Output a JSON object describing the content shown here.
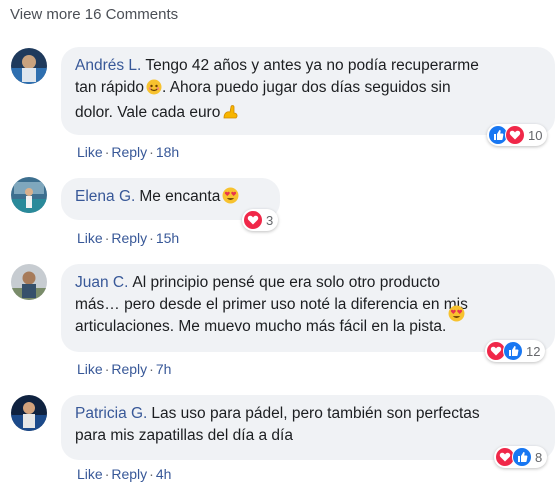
{
  "view_more": "View more 16 Comments",
  "comments": [
    {
      "author": "Andrés L.",
      "lines": [
        "Tengo 42 años y antes ya no podía recuperarme",
        "tan rápido",
        ". Ahora puedo jugar dos días seguidos sin",
        "dolor. Vale cada euro"
      ],
      "reactions": {
        "icons": [
          "like-icon",
          "love-icon"
        ],
        "count": "10"
      },
      "like_label": "Like",
      "reply_label": "Reply",
      "time": "18h"
    },
    {
      "author": "Elena G.",
      "lines": [
        "Me encanta"
      ],
      "reactions": {
        "icons": [
          "love-icon"
        ],
        "count": "3"
      },
      "like_label": "Like",
      "reply_label": "Reply",
      "time": "15h"
    },
    {
      "author": "Juan C.",
      "lines": [
        "Al principio pensé que era solo otro producto",
        "más… pero desde el primer uso noté la diferencia en mis",
        "articulaciones. Me muevo mucho más fácil en la pista."
      ],
      "reactions": {
        "icons": [
          "love-icon",
          "like-icon"
        ],
        "count": "12"
      },
      "like_label": "Like",
      "reply_label": "Reply",
      "time": "7h"
    },
    {
      "author": "Patricia G.",
      "lines": [
        "Las uso para pádel, pero también son perfectas",
        "para mis zapatillas del día a día"
      ],
      "reactions": {
        "icons": [
          "love-icon",
          "like-icon"
        ],
        "count": "8"
      },
      "like_label": "Like",
      "reply_label": "Reply",
      "time": "4h"
    }
  ],
  "separator": "·",
  "colors": {
    "link": "#385898",
    "bubble": "#f0f2f5",
    "like": "#1877f2",
    "love": "#f02849",
    "meta": "#65676b"
  }
}
